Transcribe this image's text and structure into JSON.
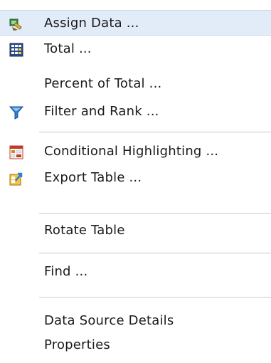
{
  "context_menu": {
    "items": [
      {
        "label": "Assign Data ...",
        "icon": "assign-data-icon",
        "highlighted": true
      },
      {
        "label": "Total ...",
        "icon": "total-icon"
      },
      {
        "label": "Percent of Total ..."
      },
      {
        "label": "Filter and Rank ...",
        "icon": "filter-icon"
      },
      {
        "label": "Conditional Highlighting ...",
        "icon": "conditional-highlighting-icon"
      },
      {
        "label": "Export Table ...",
        "icon": "export-table-icon"
      },
      {
        "label": "Rotate Table"
      },
      {
        "label": "Find ..."
      },
      {
        "label": "Data Source Details"
      },
      {
        "label": "Properties"
      }
    ]
  },
  "colors": {
    "highlight": "#e2ecf9",
    "separator": "#c9c9c9",
    "text": "#1a1a1a"
  }
}
